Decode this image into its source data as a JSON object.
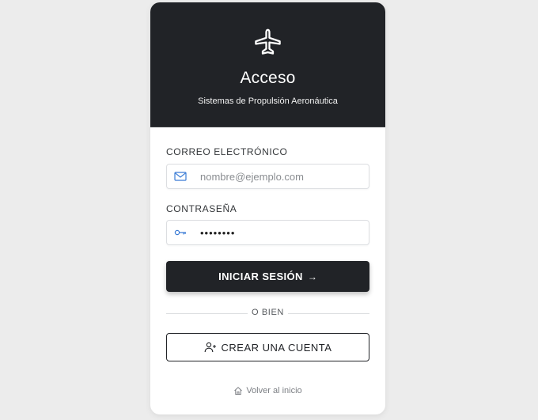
{
  "header": {
    "icon": "airplane-icon",
    "title": "Acceso",
    "subtitle": "Sistemas de Propulsión Aeronáutica"
  },
  "form": {
    "email": {
      "label": "CORREO ELECTRÓNICO",
      "placeholder": "nombre@ejemplo.com",
      "value": "",
      "icon": "envelope-icon"
    },
    "password": {
      "label": "CONTRASEÑA",
      "value": "••••••••",
      "icon": "key-icon"
    },
    "submit_label": "INICIAR SESIÓN",
    "submit_icon": "arrow-right-icon"
  },
  "divider_label": "O BIEN",
  "create_account": {
    "label": "CREAR UNA CUENTA",
    "icon": "user-plus-icon"
  },
  "back_link": {
    "label": "Volver al inicio",
    "icon": "home-icon"
  },
  "colors": {
    "dark": "#212327",
    "accent_icon": "#3a7bd5",
    "background": "#ececec"
  }
}
